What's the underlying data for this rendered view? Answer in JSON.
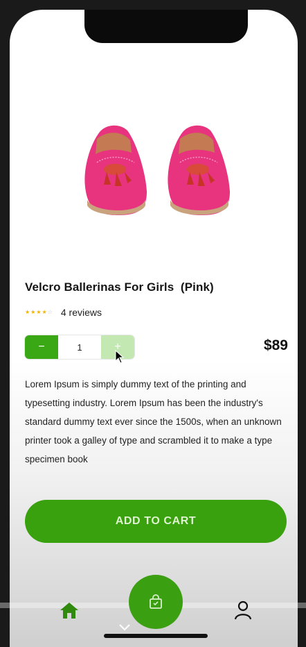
{
  "product": {
    "title": "Velcro Ballerinas For Girls  (Pink)",
    "rating": 4,
    "rating_max": 5,
    "reviews": "4 reviews",
    "price": "$89",
    "quantity": "1",
    "minus_label": "−",
    "plus_label": "+",
    "description": "Lorem Ipsum is simply dummy text of the printing and typesetting industry. Lorem Ipsum has been the industry's standard dummy text ever since the 1500s, when an unknown printer took a galley of type and scrambled it to make a type specimen book"
  },
  "actions": {
    "add_to_cart": "ADD TO CART"
  },
  "nav": {
    "items": [
      "home-icon",
      "shopping-bag-icon",
      "user-icon"
    ]
  },
  "colors": {
    "accent": "#3aa10e",
    "star": "#f2b300",
    "shoe": "#e8337f"
  }
}
